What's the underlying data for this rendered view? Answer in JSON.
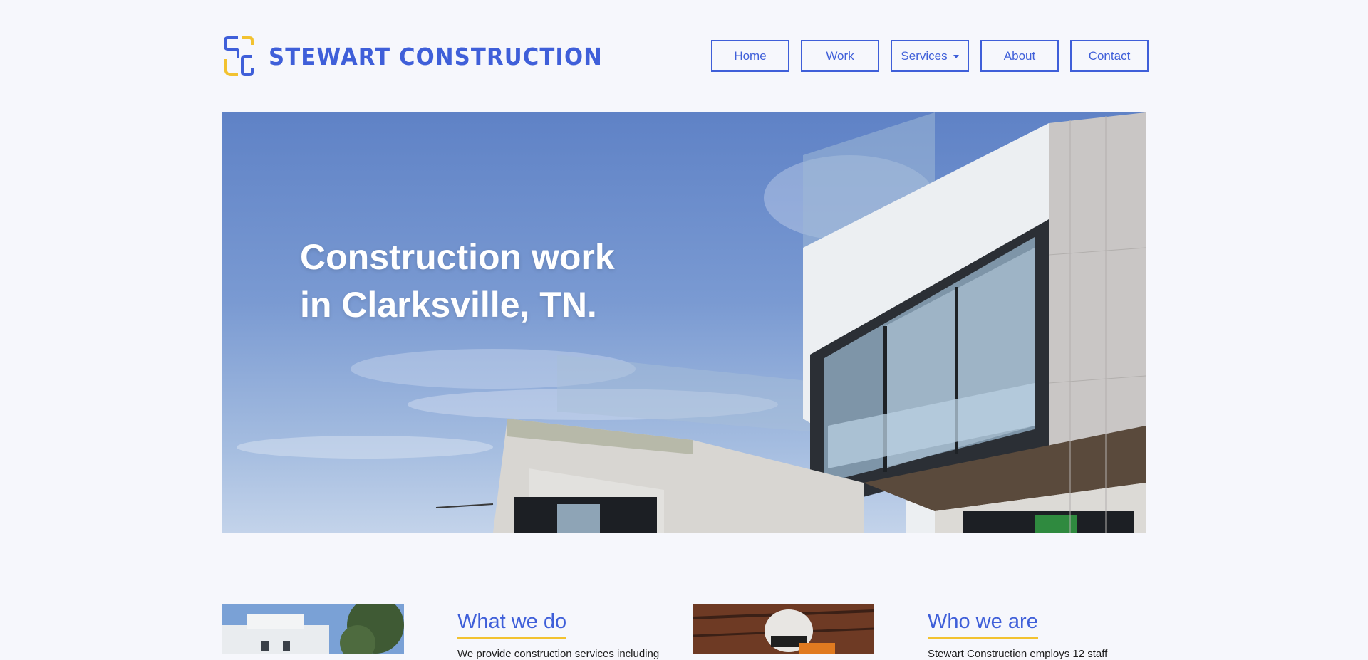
{
  "brand": {
    "name": "STEWART CONSTRUCTION",
    "colors": {
      "primary": "#3f5fd9",
      "accent": "#f2c230",
      "background": "#f6f7fc"
    }
  },
  "nav": {
    "items": [
      {
        "label": "Home"
      },
      {
        "label": "Work"
      },
      {
        "label": "Services",
        "has_dropdown": true
      },
      {
        "label": "About"
      },
      {
        "label": "Contact"
      }
    ]
  },
  "hero": {
    "title_line1": "Construction work",
    "title_line2": "in Clarksville, TN."
  },
  "sections": {
    "what_we_do": {
      "title": "What we do",
      "text": "We provide construction services including"
    },
    "who_we_are": {
      "title": "Who we are",
      "text": "Stewart Construction employs 12 staff"
    }
  }
}
